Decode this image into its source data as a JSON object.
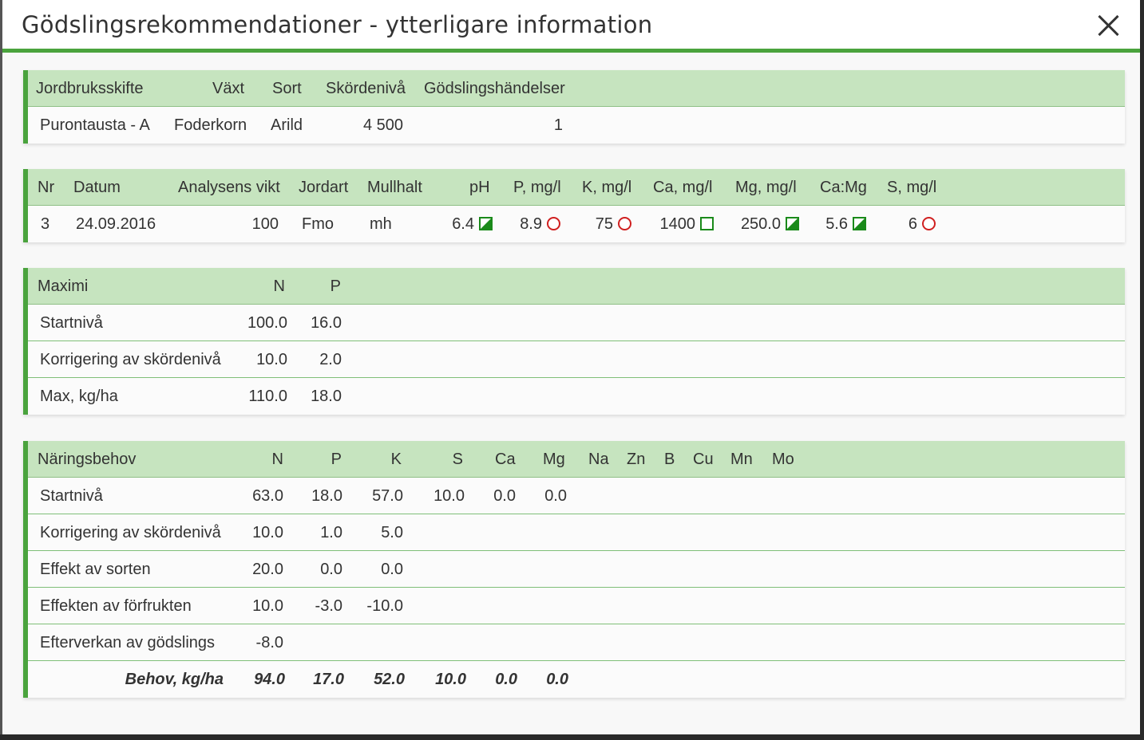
{
  "dialog": {
    "title": "Gödslingsrekommendationer - ytterligare information"
  },
  "field_table": {
    "headers": [
      "Jordbruksskifte",
      "Växt",
      "Sort",
      "Skördenivå",
      "Gödslingshändelser"
    ],
    "row": [
      "Purontausta - A",
      "Foderkorn",
      "Arild",
      "4 500",
      "1"
    ]
  },
  "soil_table": {
    "headers": [
      "Nr",
      "Datum",
      "Analysens vikt",
      "Jordart",
      "Mullhalt",
      "pH",
      "P, mg/l",
      "K, mg/l",
      "Ca, mg/l",
      "Mg, mg/l",
      "Ca:Mg",
      "S, mg/l"
    ],
    "row": {
      "nr": "3",
      "datum": "24.09.2016",
      "vikt": "100",
      "jordart": "Fmo",
      "mullhalt": "mh",
      "ph": "6.4",
      "p": "8.9",
      "k": "75",
      "ca": "1400",
      "mg": "250.0",
      "camg": "5.6",
      "s": "6"
    },
    "icons": {
      "ph": "half-filled-square-icon",
      "p": "red-circle-icon",
      "k": "red-circle-icon",
      "ca": "empty-square-icon",
      "mg": "half-filled-square-icon",
      "camg": "half-filled-square-icon",
      "s": "red-circle-icon"
    }
  },
  "maximi_table": {
    "headers": [
      "Maximi",
      "N",
      "P"
    ],
    "rows": [
      {
        "label": "Startnivå",
        "n": "100.0",
        "p": "16.0"
      },
      {
        "label": "Korrigering av skördenivå",
        "n": "10.0",
        "p": "2.0"
      },
      {
        "label": "Max, kg/ha",
        "n": "110.0",
        "p": "18.0"
      }
    ]
  },
  "naring_table": {
    "headers": [
      "Näringsbehov",
      "N",
      "P",
      "K",
      "S",
      "Ca",
      "Mg",
      "Na",
      "Zn",
      "B",
      "Cu",
      "Mn",
      "Mo"
    ],
    "rows": [
      {
        "label": "Startnivå",
        "n": "63.0",
        "p": "18.0",
        "k": "57.0",
        "s": "10.0",
        "ca": "0.0",
        "mg": "0.0"
      },
      {
        "label": "Korrigering av skördenivå",
        "n": "10.0",
        "p": "1.0",
        "k": "5.0"
      },
      {
        "label": "Effekt av sorten",
        "n": "20.0",
        "p": "0.0",
        "k": "0.0"
      },
      {
        "label": "Effekten av förfrukten",
        "n": "10.0",
        "p": "-3.0",
        "k": "-10.0"
      },
      {
        "label": "Efterverkan av gödslings",
        "n": "-8.0"
      }
    ],
    "total": {
      "label": "Behov, kg/ha",
      "n": "94.0",
      "p": "17.0",
      "k": "52.0",
      "s": "10.0",
      "ca": "0.0",
      "mg": "0.0"
    }
  },
  "colors": {
    "accent": "#4aa33d",
    "header_bg": "#c6e4bf",
    "good": "#1a8a1a",
    "bad": "#d02020"
  }
}
